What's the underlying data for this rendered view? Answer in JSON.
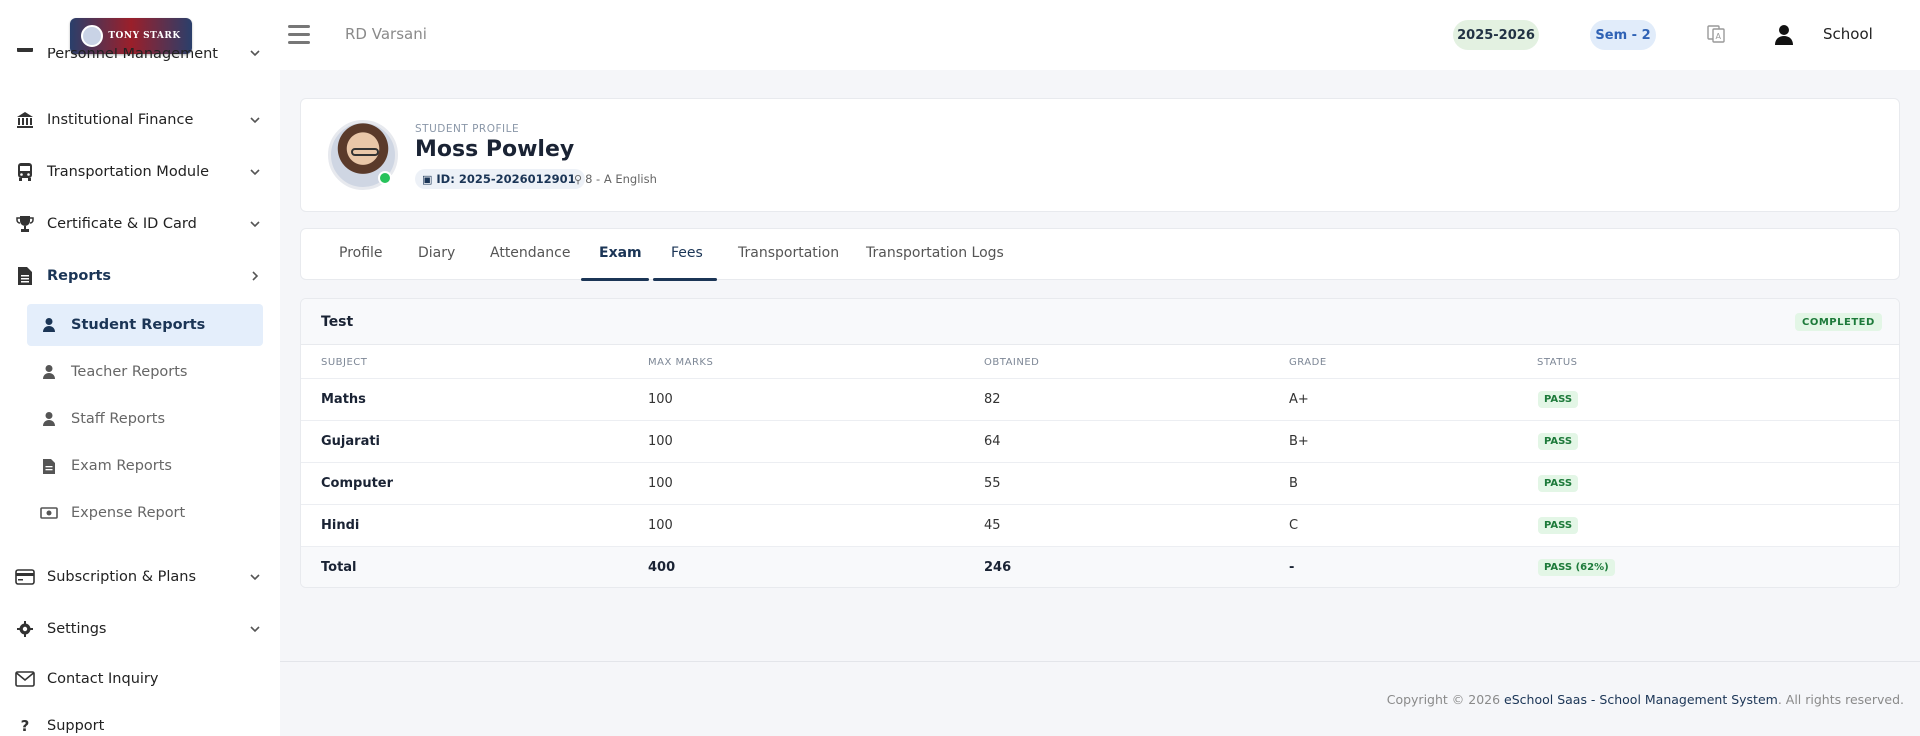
{
  "header": {
    "school_name": "RD Varsani",
    "academic_year": "2025-2026",
    "semester": "Sem - 2",
    "user_label": "School"
  },
  "sidebar": {
    "items": [
      {
        "label": "Personnel Management",
        "icon": "users-icon"
      },
      {
        "label": "Institutional Finance",
        "icon": "bank-icon"
      },
      {
        "label": "Transportation Module",
        "icon": "bus-icon"
      },
      {
        "label": "Certificate & ID Card",
        "icon": "trophy-icon"
      },
      {
        "label": "Reports",
        "icon": "document-icon"
      },
      {
        "label": "Subscription & Plans",
        "icon": "credit-card-icon"
      },
      {
        "label": "Settings",
        "icon": "gear-icon"
      },
      {
        "label": "Contact Inquiry",
        "icon": "envelope-icon"
      },
      {
        "label": "Support",
        "icon": "question-icon"
      }
    ],
    "report_subitems": [
      {
        "label": "Student Reports",
        "icon": "user-icon"
      },
      {
        "label": "Teacher Reports",
        "icon": "user-icon"
      },
      {
        "label": "Staff Reports",
        "icon": "user-icon"
      },
      {
        "label": "Exam Reports",
        "icon": "document-icon"
      },
      {
        "label": "Expense Report",
        "icon": "money-icon"
      }
    ]
  },
  "profile": {
    "kicker": "STUDENT PROFILE",
    "name": "Moss Powley",
    "id": "ID: 2025-2026012901",
    "class_info": "8 - A English"
  },
  "tabs": [
    "Profile",
    "Diary",
    "Attendance",
    "Exam",
    "Fees",
    "Transportation",
    "Transportation Logs"
  ],
  "exam": {
    "title": "Test",
    "status": "COMPLETED",
    "columns": [
      "SUBJECT",
      "MAX MARKS",
      "OBTAINED",
      "GRADE",
      "STATUS"
    ],
    "rows": [
      {
        "subject": "Maths",
        "max": "100",
        "obtained": "82",
        "grade": "A+",
        "status": "PASS"
      },
      {
        "subject": "Gujarati",
        "max": "100",
        "obtained": "64",
        "grade": "B+",
        "status": "PASS"
      },
      {
        "subject": "Computer",
        "max": "100",
        "obtained": "55",
        "grade": "B",
        "status": "PASS"
      },
      {
        "subject": "Hindi",
        "max": "100",
        "obtained": "45",
        "grade": "C",
        "status": "PASS"
      }
    ],
    "total": {
      "subject": "Total",
      "max": "400",
      "obtained": "246",
      "grade": "-",
      "status": "PASS (62%)"
    }
  },
  "footer": {
    "prefix": "Copyright © 2026 ",
    "brand": "eSchool Saas - School Management System",
    "suffix": ". All rights reserved."
  },
  "colors": {
    "accent": "#1b3556",
    "active_bg": "#e4eefb",
    "pass_bg": "#e3f6e6",
    "pass_text": "#1d7a3a",
    "online": "#27c25b"
  }
}
